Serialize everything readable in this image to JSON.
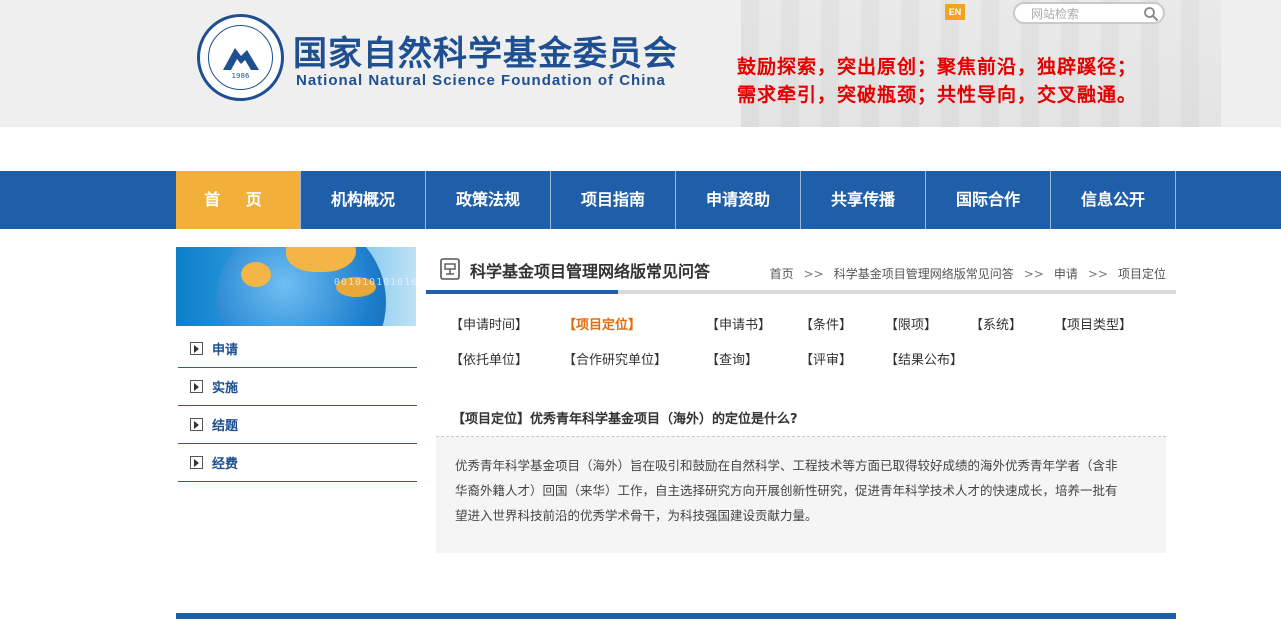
{
  "header": {
    "title_cn": "国家自然科学基金委员会",
    "title_en": "National Natural Science Foundation of China",
    "logo_year": "1986",
    "slogan_line1": "鼓励探索，突出原创；聚焦前沿，独辟蹊径；",
    "slogan_line2": "需求牵引，突破瓶颈；共性导向，交叉融通。",
    "en_label": "EN",
    "search_placeholder": "网站检索"
  },
  "nav": {
    "items": [
      "首 页",
      "机构概况",
      "政策法规",
      "项目指南",
      "申请资助",
      "共享传播",
      "国际合作",
      "信息公开"
    ],
    "active_index": 0
  },
  "sidebar": {
    "banner_text": "0010101010101",
    "items": [
      "申请",
      "实施",
      "结题",
      "经费"
    ]
  },
  "main": {
    "title": "科学基金项目管理网络版常见问答",
    "breadcrumb": [
      "首页",
      "科学基金项目管理网络版常见问答",
      "申请",
      "项目定位"
    ],
    "breadcrumb_sep": ">>",
    "tags_row1": [
      "【申请时间】",
      "【项目定位】",
      "【申请书】",
      "【条件】",
      "【限项】",
      "【系统】",
      "【项目类型】"
    ],
    "tags_row2": [
      "【依托单位】",
      "【合作研究单位】",
      "【查询】",
      "【评审】",
      "【结果公布】"
    ],
    "selected_tag": "【项目定位】",
    "question": "【项目定位】优秀青年科学基金项目（海外）的定位是什么?",
    "answer_line1": "优秀青年科学基金项目（海外）旨在吸引和鼓励在自然科学、工程技术等方面已取得较好成绩的海外优秀青年学者（含非",
    "answer_line2": "华裔外籍人才）回国（来华）工作，自主选择研究方向开展创新性研究，促进青年科学技术人才的快速成长，培养一批有",
    "answer_line3": "望进入世界科技前沿的优秀学术骨干，为科技强国建设贡献力量。"
  },
  "colors": {
    "brand_blue": "#1f5fa9",
    "nav_active": "#f2b03a",
    "slogan_red": "#e50000",
    "selected_tag": "#e36d0d"
  }
}
